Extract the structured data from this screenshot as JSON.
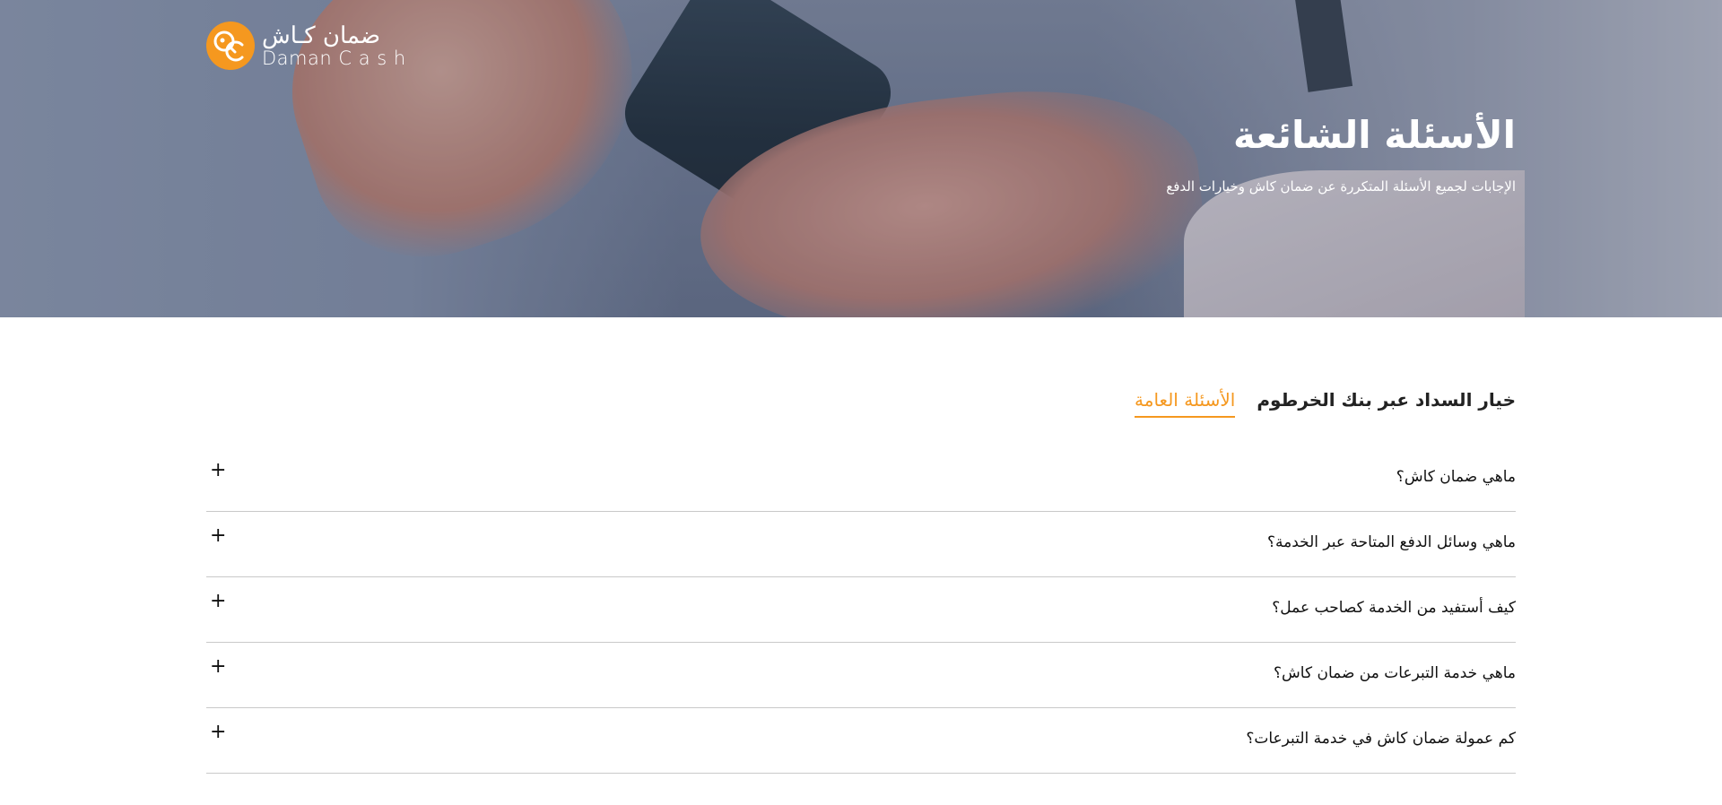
{
  "header": {
    "logo_ar": "ضمان كـاش",
    "logo_en": "Daman C a s h",
    "title": "الأسئلة الشائعة",
    "subtitle": "الإجابات لجميع الأسئلة المتكررة عن ضمان كاش وخيارات الدفع"
  },
  "tabs": [
    {
      "label": "الأسئلة العامة",
      "active": true
    },
    {
      "label": "خيار السداد عبر بنك الخرطوم",
      "active": false
    }
  ],
  "faq": [
    {
      "question": "ماهي ضمان كاش؟",
      "toggle": "+"
    },
    {
      "question": "ماهي وسائل الدفع المتاحة عبر الخدمة؟",
      "toggle": "+"
    },
    {
      "question": "كيف أستفيد من الخدمة كصاحب عمل؟",
      "toggle": "+"
    },
    {
      "question": "ماهي خدمة التبرعات من ضمان كاش؟",
      "toggle": "+"
    },
    {
      "question": "كم عمولة ضمان كاش في خدمة التبرعات؟",
      "toggle": "+"
    }
  ],
  "colors": {
    "accent": "#f5981f",
    "text": "#111111",
    "divider": "#c9c9c9"
  },
  "icons": {
    "logo": "daman-cash-logo-icon",
    "expand": "plus-icon"
  }
}
